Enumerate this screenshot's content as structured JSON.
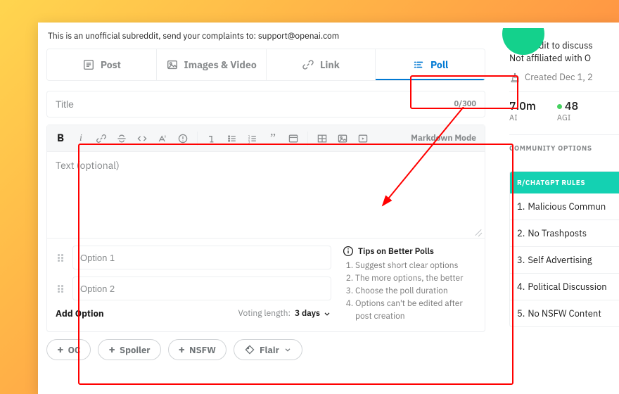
{
  "notice": "This is an unofficial subreddit, send your complaints to: support@openai.com",
  "tabs": {
    "post": {
      "label": "Post"
    },
    "images": {
      "label": "Images & Video"
    },
    "link": {
      "label": "Link"
    },
    "poll": {
      "label": "Poll"
    }
  },
  "title": {
    "placeholder": "Title",
    "value": "",
    "counter": "0/300"
  },
  "editor": {
    "body_placeholder": "Text (optional)",
    "body_value": "",
    "markdown_mode": "Markdown Mode"
  },
  "poll": {
    "opt1_placeholder": "Option 1",
    "opt2_placeholder": "Option 2",
    "opt1_value": "",
    "opt2_value": "",
    "add_option": "Add Option",
    "voting_label": "Voting length:",
    "voting_value": "3 days"
  },
  "tips": {
    "heading": "Tips on Better Polls",
    "items": [
      "Suggest short clear options",
      "The more options, the better",
      "Choose the poll duration",
      "Options can't be edited after post creation"
    ]
  },
  "chips": {
    "oc": "OC",
    "spoiler": "Spoiler",
    "nsfw": "NSFW",
    "flair": "Flair"
  },
  "sidebar": {
    "desc_line1": "Subreddit to discuss",
    "desc_line2": "Not affiliated with O",
    "created_label": "Created Dec 1, 2",
    "members": {
      "value": "7.0m",
      "label": "AI"
    },
    "online": {
      "value": "48",
      "label": "AGI"
    },
    "community_options": "COMMUNITY OPTIONS",
    "rules_header": "R/CHATGPT RULES",
    "rules": [
      "Malicious Commun",
      "No Trashposts",
      "Self Advertising",
      "Political Discussion",
      "No NSFW Content"
    ]
  }
}
